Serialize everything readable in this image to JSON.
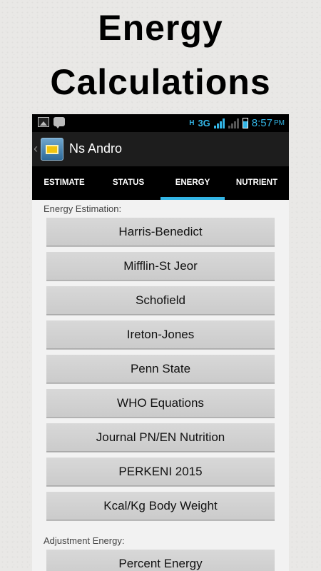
{
  "headline": {
    "line1": "Energy",
    "line2": "Calculations"
  },
  "status_bar": {
    "network_h": "H",
    "network_type": "3G",
    "time": "8:57",
    "ampm": "PM",
    "accent_color": "#33b5e5",
    "icons": [
      "gallery-icon",
      "chat-icon",
      "signal-icon",
      "battery-icon"
    ]
  },
  "action_bar": {
    "app_icon": "app-envelope-icon",
    "title": "Ns Andro"
  },
  "tabs": [
    {
      "label": "ESTIMATE",
      "active": false
    },
    {
      "label": "STATUS",
      "active": false
    },
    {
      "label": "ENERGY",
      "active": true
    },
    {
      "label": "NUTRIENT",
      "active": false
    }
  ],
  "energy_section": {
    "label": "Energy Estimation:",
    "buttons": [
      "Harris-Benedict",
      "Mifflin-St Jeor",
      "Schofield",
      "Ireton-Jones",
      "Penn State",
      "WHO Equations",
      "Journal PN/EN Nutrition",
      "PERKENI 2015",
      "Kcal/Kg Body Weight"
    ]
  },
  "adjustment_section": {
    "label": "Adjustment Energy:",
    "buttons": [
      "Percent Energy"
    ]
  }
}
